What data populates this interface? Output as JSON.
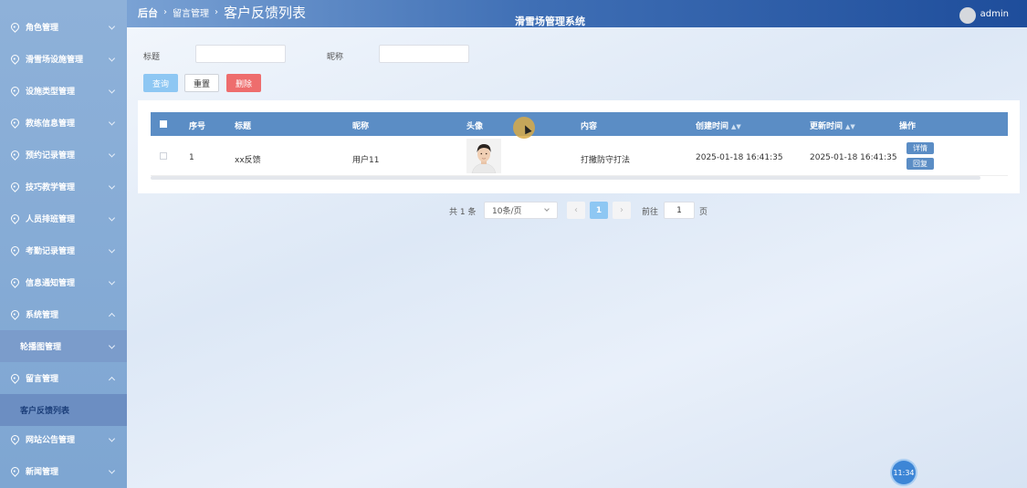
{
  "header": {
    "breadcrumb_home": "后台",
    "breadcrumb_section": "留言管理",
    "breadcrumb_current": "客户反馈列表",
    "system_title": "滑雪场管理系统",
    "username": "admin"
  },
  "sidebar": {
    "items": [
      {
        "label": "角色管理"
      },
      {
        "label": "滑雪场设施管理"
      },
      {
        "label": "设施类型管理"
      },
      {
        "label": "教练信息管理"
      },
      {
        "label": "预约记录管理"
      },
      {
        "label": "技巧教学管理"
      },
      {
        "label": "人员排班管理"
      },
      {
        "label": "考勤记录管理"
      },
      {
        "label": "信息通知管理"
      },
      {
        "label": "系统管理"
      },
      {
        "label": "轮播图管理"
      },
      {
        "label": "留言管理"
      },
      {
        "label": "客户反馈列表"
      },
      {
        "label": "网站公告管理"
      },
      {
        "label": "新闻管理"
      }
    ]
  },
  "search": {
    "title_label": "标题",
    "nickname_label": "昵称",
    "query_label": "查询",
    "reset_label": "重置",
    "delete_label": "删除"
  },
  "table": {
    "columns": [
      "序号",
      "标题",
      "昵称",
      "头像",
      "内容",
      "创建时间",
      "更新时间",
      "操作"
    ],
    "rows": [
      {
        "index": "1",
        "title": "xx反馈",
        "nickname": "用户11",
        "content": "打撒防守打法",
        "created": "2025-01-18 16:41:35",
        "updated": "2025-01-18 16:41:35",
        "detail_label": "详情",
        "reply_label": "回复"
      }
    ]
  },
  "pagination": {
    "total_text": "共 1 条",
    "page_size": "10条/页",
    "current_page": "1",
    "goto_label": "前往",
    "goto_value": "1",
    "page_unit": "页"
  },
  "clock": "11:34",
  "colors": {
    "sidebar": "#8eb1d9",
    "header_dark": "#1e4d9b",
    "table_head": "#5b8dc5",
    "query_button": "#8ec7f3",
    "delete_button": "#ee6d6d"
  }
}
